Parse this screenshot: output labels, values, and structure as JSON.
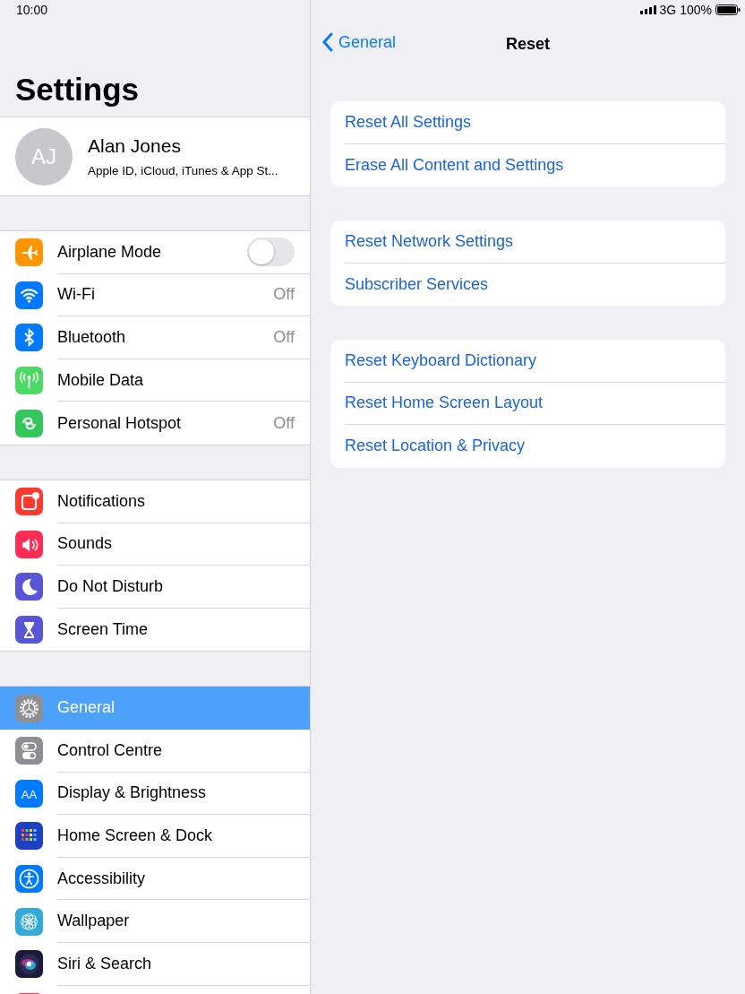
{
  "status_bar": {
    "time": "10:00",
    "network": "3G",
    "battery": "100%"
  },
  "sidebar": {
    "title": "Settings",
    "profile": {
      "initials": "AJ",
      "name": "Alan Jones",
      "subtitle": "Apple ID, iCloud, iTunes & App St..."
    },
    "groups": [
      {
        "items": [
          {
            "kind": "airplane",
            "color": "#ff9500",
            "label": "Airplane Mode",
            "on": false,
            "selected": false
          },
          {
            "kind": "wifi",
            "color": "#007aff",
            "label": "Wi-Fi",
            "detail": "Off",
            "selected": false
          },
          {
            "kind": "bluetooth",
            "color": "#007aff",
            "label": "Bluetooth",
            "detail": "Off",
            "selected": false
          },
          {
            "kind": "antenna",
            "color": "#4cd964",
            "label": "Mobile Data",
            "selected": false
          },
          {
            "kind": "hotspot",
            "color": "#34c759",
            "label": "Personal Hotspot",
            "detail": "Off",
            "selected": false
          }
        ]
      },
      {
        "items": [
          {
            "kind": "notifications",
            "color": "#ff3b30",
            "label": "Notifications",
            "selected": false
          },
          {
            "kind": "sounds",
            "color": "#ff2d55",
            "label": "Sounds",
            "selected": false
          },
          {
            "kind": "moon",
            "color": "#5856d6",
            "label": "Do Not Disturb",
            "selected": false
          },
          {
            "kind": "hourglass",
            "color": "#5856d6",
            "label": "Screen Time",
            "selected": false
          }
        ]
      },
      {
        "items": [
          {
            "kind": "gear",
            "color": "#8e8e93",
            "label": "General",
            "selected": true
          },
          {
            "kind": "toggles",
            "color": "#8e8e93",
            "label": "Control Centre",
            "selected": false
          },
          {
            "kind": "textsize",
            "color": "#007aff",
            "label": "Display & Brightness",
            "icon_text": "AA",
            "selected": false
          },
          {
            "kind": "grid",
            "color": "#1c3fc4",
            "label": "Home Screen & Dock",
            "selected": false
          },
          {
            "kind": "accessibility",
            "color": "#007aff",
            "label": "Accessibility",
            "selected": false
          },
          {
            "kind": "flower",
            "color": "#34aadc",
            "label": "Wallpaper",
            "selected": false
          },
          {
            "kind": "siri",
            "color": "#1c1c3a",
            "label": "Siri & Search",
            "selected": false
          },
          {
            "kind": "blank",
            "color": "#ff2d55",
            "selected": false
          }
        ]
      }
    ]
  },
  "detail": {
    "back": "General",
    "title": "Reset",
    "groups": [
      {
        "items": [
          "Reset All Settings",
          "Erase All Content and Settings"
        ]
      },
      {
        "items": [
          "Reset Network Settings",
          "Subscriber Services"
        ]
      },
      {
        "items": [
          "Reset Keyboard Dictionary",
          "Reset Home Screen Layout",
          "Reset Location & Privacy"
        ]
      }
    ]
  }
}
